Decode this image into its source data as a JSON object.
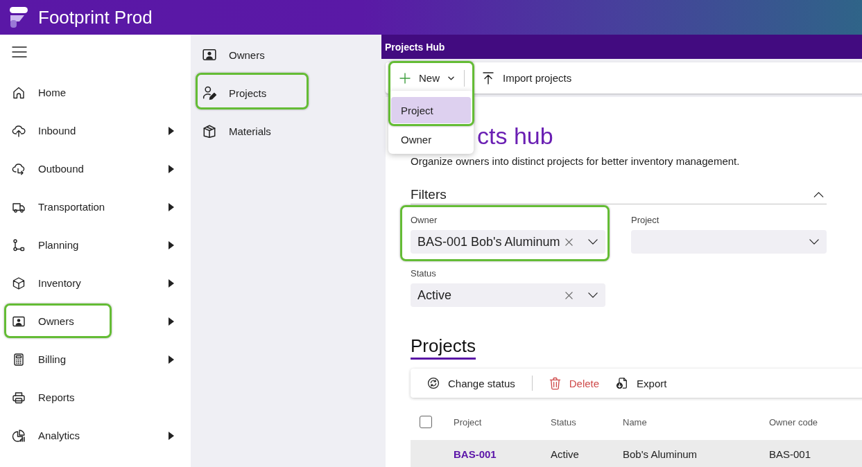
{
  "app": {
    "title": "Footprint Prod"
  },
  "sidebar": {
    "items": [
      {
        "label": "Home",
        "has_submenu": false,
        "highlighted": false
      },
      {
        "label": "Inbound",
        "has_submenu": true,
        "highlighted": false
      },
      {
        "label": "Outbound",
        "has_submenu": true,
        "highlighted": false
      },
      {
        "label": "Transportation",
        "has_submenu": true,
        "highlighted": false
      },
      {
        "label": "Planning",
        "has_submenu": true,
        "highlighted": false
      },
      {
        "label": "Inventory",
        "has_submenu": true,
        "highlighted": false
      },
      {
        "label": "Owners",
        "has_submenu": true,
        "highlighted": true
      },
      {
        "label": "Billing",
        "has_submenu": true,
        "highlighted": false
      },
      {
        "label": "Reports",
        "has_submenu": false,
        "highlighted": false
      },
      {
        "label": "Analytics",
        "has_submenu": true,
        "highlighted": false
      }
    ]
  },
  "subnav": {
    "items": [
      {
        "label": "Owners",
        "highlighted": false
      },
      {
        "label": "Projects",
        "highlighted": true
      },
      {
        "label": "Materials",
        "highlighted": false
      }
    ]
  },
  "page": {
    "title": "Projects Hub"
  },
  "toolbar": {
    "new_button": {
      "label": "New",
      "expanded": true,
      "highlighted": true,
      "menu": [
        {
          "label": "Project",
          "selected": true
        },
        {
          "label": "Owner",
          "selected": false
        }
      ]
    },
    "import_button": {
      "label": "Import projects"
    }
  },
  "heading": "cts hub",
  "description": "Organize owners into distinct projects for better inventory management.",
  "filters": {
    "title": "Filters",
    "expanded": true,
    "fields": [
      {
        "label": "Owner",
        "value": "BAS-001 Bob's Aluminum",
        "highlighted": true
      },
      {
        "label": "Project",
        "highlighted": false
      },
      {
        "label": "Status",
        "value": "Active",
        "highlighted": false
      }
    ]
  },
  "tabs": [
    {
      "label": "Projects",
      "selected": true
    }
  ],
  "actions": [
    {
      "label": "Change status",
      "kind": "default",
      "divider_after": true
    },
    {
      "label": "Delete",
      "kind": "danger",
      "divider_after": false
    },
    {
      "label": "Export",
      "kind": "default",
      "divider_after": false
    }
  ],
  "table": {
    "select_all": {
      "checked": false
    },
    "columns": [
      {
        "label": "Project",
        "kind": "link"
      },
      {
        "label": "Status",
        "kind": "text"
      },
      {
        "label": "Name",
        "kind": "text"
      },
      {
        "label": "Owner code",
        "kind": "text"
      }
    ],
    "rows": [
      {
        "cells": [
          "BAS-001",
          "Active",
          "Bob's Aluminum",
          "BAS-001"
        ],
        "selected": true
      }
    ]
  }
}
